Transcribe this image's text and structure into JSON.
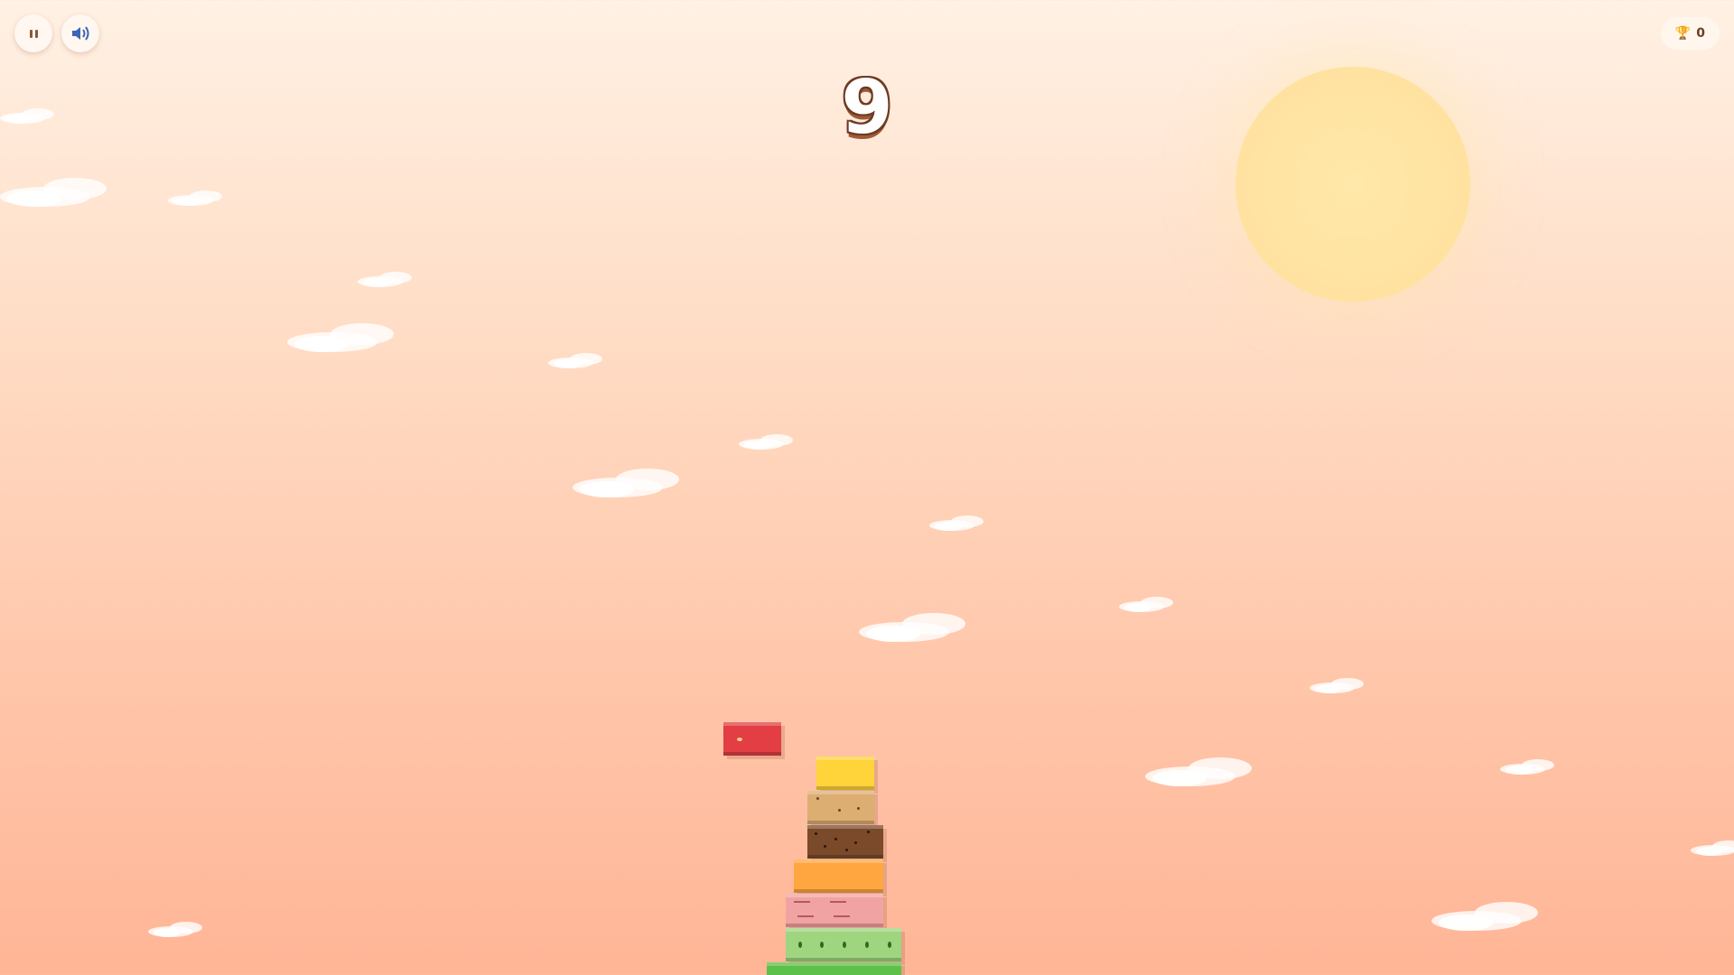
{
  "hud": {
    "pause_icon": "pause-icon",
    "sound_icon": "speaker-icon",
    "trophy_icon": "trophy-icon",
    "trophy_glyph": "🏆",
    "best_score": "0"
  },
  "score": "9",
  "colors": {
    "score_outline": "#6e3b22",
    "sun": "#ffe2a0",
    "sky_top": "#fff1e4",
    "sky_bottom": "#ffb596"
  },
  "falling_block": {
    "name": "strawberry",
    "color": "#e23e43"
  },
  "tower": [
    {
      "name": "lemon",
      "color": "#ffd33a"
    },
    {
      "name": "biscuit",
      "color": "#dcae72"
    },
    {
      "name": "chocolate",
      "color": "#7a4a2b"
    },
    {
      "name": "orange",
      "color": "#ffa640"
    },
    {
      "name": "strawberry-cream",
      "color": "#f1a3a3"
    },
    {
      "name": "kiwi",
      "color": "#9fd57f"
    },
    {
      "name": "grass",
      "color": "#5cc04a"
    }
  ]
}
